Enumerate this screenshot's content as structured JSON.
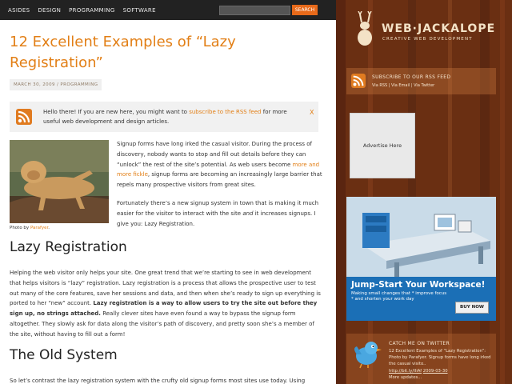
{
  "nav": {
    "items": [
      "ASIDES",
      "DESIGN",
      "PROGRAMMING",
      "SOFTWARE"
    ],
    "search_button": "SEARCH",
    "search_value": ""
  },
  "post": {
    "title": "12 Excellent Examples of “Lazy Registration”",
    "meta": "MARCH 30, 2009 / PROGRAMMING",
    "notice_pre": "Hello there! If you are new here, you might want to ",
    "notice_link": "subscribe to the RSS feed",
    "notice_post": " for more useful web development and design articles.",
    "notice_close": "X",
    "photo_caption_pre": "Photo by ",
    "photo_caption_link": "Parafyer",
    "photo_caption_post": ".",
    "para1_pre": "Signup forms have long irked the casual visitor. During the process of discovery, nobody wants to stop and fill out details before they can “unlock” the rest of the site’s potential. As web users become ",
    "para1_link": "more and more fickle",
    "para1_post": ", signup forms are becoming an increasingly large barrier that repels many prospective visitors from great sites.",
    "para2_pre": "Fortunately there’s a new signup system in town that is making it much easier for the visitor to interact with the site ",
    "para2_em": "and",
    "para2_post": " it increases signups. I give you: Lazy Registration.",
    "h_lazy": "Lazy Registration",
    "para3_pre": "Helping the web visitor only helps your site. One great trend that we’re starting to see in web development that helps visitors is “lazy” registration. Lazy registration is a process that allows the prospective user to test out many of the core features, save her sessions and data, and then when she’s ready to sign up everything is ported to her “new” account. ",
    "para3_bold": "Lazy registration is a way to allow users to try the site out before they sign up, no strings attached.",
    "para3_post": " Really clever sites have even found a way to bypass the signup form altogether. They slowly ask for data along the visitor’s path of discovery, and pretty soon she’s a member of the site, without having to fill out a form!",
    "h_old": "The Old System",
    "para4": "So let’s contrast the lazy registration system with the crufty old signup forms most sites use today. Using"
  },
  "sidebar": {
    "logo_text": "WEB·JACKALOPE",
    "logo_sub": "CREATIVE WEB DEVELOPMENT",
    "rss_title": "SUBSCRIBE TO OUR RSS FEED",
    "rss_links": "Via RSS | Via Email | Via Twitter",
    "ad_here": "Advertise Here",
    "ad_headline": "Jump-Start Your Workspace!",
    "ad_sub": "Making small changes that * improve focus * and shorten your work day",
    "ad_buy": "BUY NOW",
    "twitter_title": "CATCH ME ON TWITTER",
    "twitter_text": "12 Excellent Examples of “Lazy Registration”: Photo by Parafyer. Signup forms have long irked the casual visito..",
    "twitter_link": "http://bit.ly/IIiAf",
    "twitter_date": "2009-03-30",
    "twitter_more": "More updates..."
  },
  "colors": {
    "accent": "#e27f16",
    "wood": "#6a2f12",
    "topbar": "#222222",
    "ad_blue": "#1b6fb6"
  },
  "icons": [
    "rss-icon",
    "jackalope-logo",
    "twitter-bird-icon",
    "lion-photo",
    "workspace-desk-illustration"
  ]
}
